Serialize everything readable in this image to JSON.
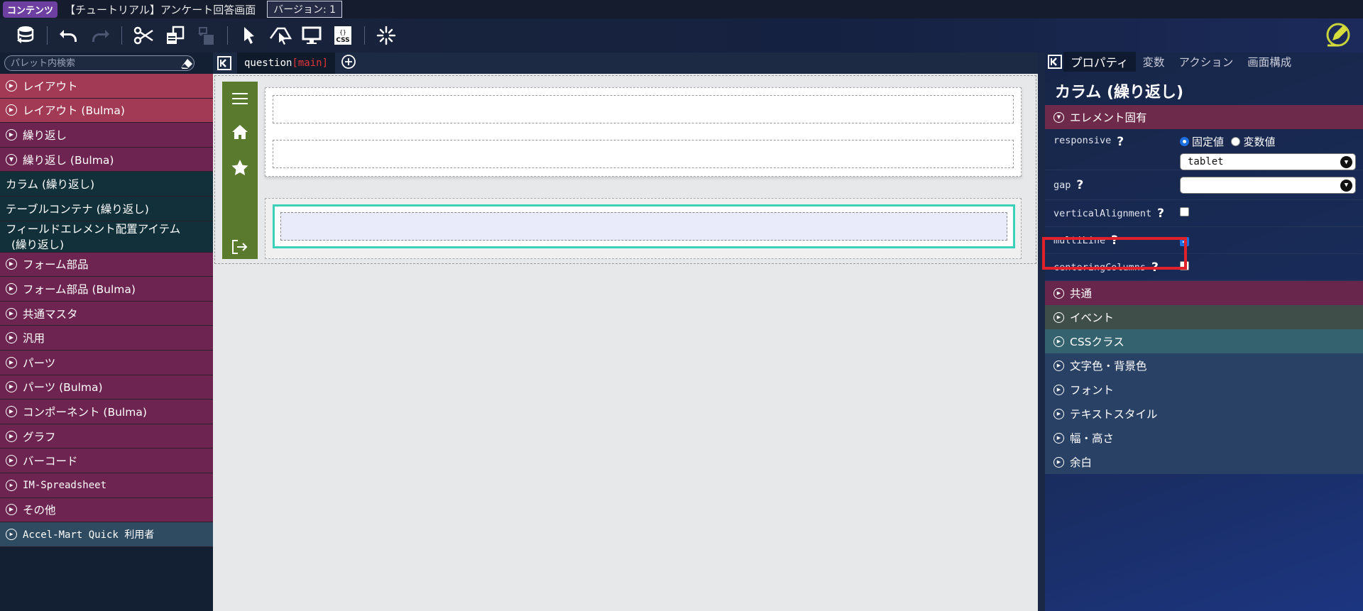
{
  "titlebar": {
    "badge": "コンテンツ",
    "title": "【チュートリアル】アンケート回答画面",
    "version": "バージョン: 1"
  },
  "toolbar": {
    "icons": [
      "database-icon",
      "undo-icon",
      "redo-icon",
      "cut-icon",
      "copy-icon",
      "paste-icon",
      "pointer-icon",
      "select-tool-icon",
      "monitor-icon",
      "css-icon",
      "sparkle-icon",
      "edit-pencil-icon"
    ]
  },
  "palette": {
    "search_placeholder": "パレット内検索",
    "items": [
      {
        "label": "レイアウト",
        "style": "red",
        "expanded": false
      },
      {
        "label": "レイアウト (Bulma)",
        "style": "red",
        "expanded": false
      },
      {
        "label": "繰り返し",
        "style": "purple",
        "expanded": false
      },
      {
        "label": "繰り返し (Bulma)",
        "style": "purple",
        "expanded": true
      },
      {
        "label": "カラム (繰り返し)",
        "style": "sub"
      },
      {
        "label": "テーブルコンテナ (繰り返し)",
        "style": "sub"
      },
      {
        "label": "フィールドエレメント配置アイテム",
        "label2": "(繰り返し)",
        "style": "sub"
      },
      {
        "label": "フォーム部品",
        "style": "purple",
        "expanded": false
      },
      {
        "label": "フォーム部品 (Bulma)",
        "style": "purple",
        "expanded": false
      },
      {
        "label": "共通マスタ",
        "style": "purple",
        "expanded": false
      },
      {
        "label": "汎用",
        "style": "purple",
        "expanded": false
      },
      {
        "label": "パーツ",
        "style": "purple",
        "expanded": false
      },
      {
        "label": "パーツ (Bulma)",
        "style": "purple",
        "expanded": false
      },
      {
        "label": "コンポーネント (Bulma)",
        "style": "purple",
        "expanded": false
      },
      {
        "label": "グラフ",
        "style": "purple",
        "expanded": false
      },
      {
        "label": "バーコード",
        "style": "purple",
        "expanded": false
      },
      {
        "label": "IM-Spreadsheet",
        "style": "purple",
        "expanded": false
      },
      {
        "label": "その他",
        "style": "purple",
        "expanded": false
      },
      {
        "label": "Accel-Mart Quick 利用者",
        "style": "blue",
        "expanded": false
      }
    ]
  },
  "canvas": {
    "tab_name": "question",
    "tab_suffix": "[main]"
  },
  "properties": {
    "tabs": [
      "プロパティ",
      "変数",
      "アクション",
      "画面構成"
    ],
    "active_tab": 0,
    "title": "カラム (繰り返し)",
    "section_element": "エレメント固有",
    "fields": {
      "responsive": {
        "label": "responsive",
        "radio_fixed": "固定値",
        "radio_var": "変数値",
        "selected": "tablet"
      },
      "gap": {
        "label": "gap",
        "value": ""
      },
      "verticalAlignment": {
        "label": "verticalAlignment",
        "checked": false
      },
      "multiLine": {
        "label": "multiLine",
        "checked": true
      },
      "centeringColumns": {
        "label": "centeringColumns",
        "checked": false
      }
    },
    "sections": [
      "共通",
      "イベント",
      "CSSクラス",
      "文字色・背景色",
      "フォント",
      "テキストスタイル",
      "幅・高さ",
      "余白"
    ]
  }
}
